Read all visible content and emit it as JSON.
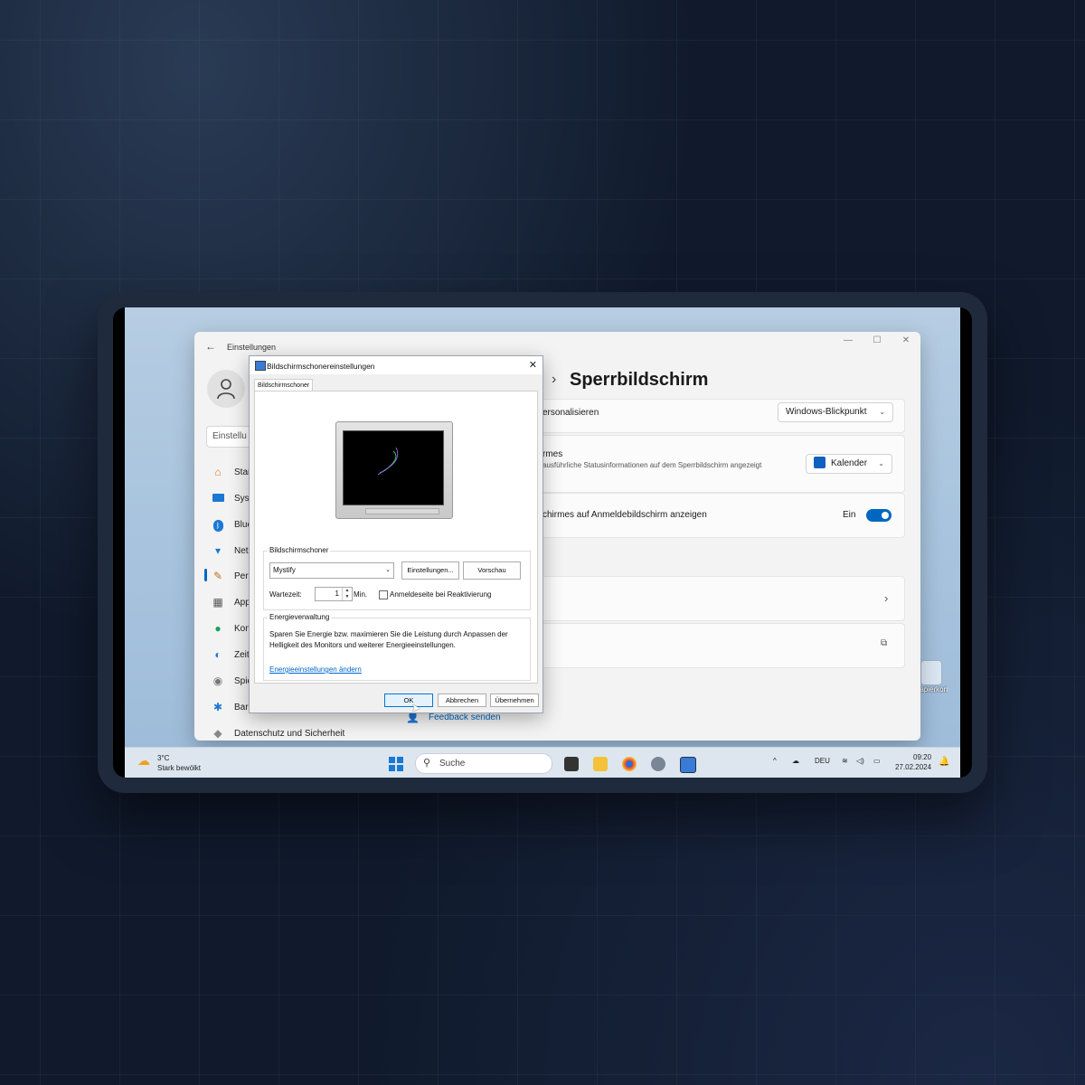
{
  "settings_window": {
    "title": "Einstellungen",
    "search_placeholder": "Einstellu",
    "breadcrumb_chevron": "›",
    "page_title": "Sperrbildschirm",
    "nav": [
      {
        "label": "Star",
        "icon": "home-icon"
      },
      {
        "label": "Syst",
        "icon": "system-icon"
      },
      {
        "label": "Blue",
        "icon": "bluetooth-icon"
      },
      {
        "label": "Net",
        "icon": "wifi-icon"
      },
      {
        "label": "Pers",
        "icon": "brush-icon"
      },
      {
        "label": "App",
        "icon": "apps-icon"
      },
      {
        "label": "Kon",
        "icon": "accounts-icon"
      },
      {
        "label": "Zeit",
        "icon": "time-icon"
      },
      {
        "label": "Spie",
        "icon": "gaming-icon"
      },
      {
        "label": "Barr",
        "icon": "accessibility-icon"
      },
      {
        "label": "Datenschutz und Sicherheit",
        "icon": "shield-icon"
      }
    ],
    "rows": {
      "personalize_label": "ersonalisieren",
      "personalize_value": "Windows-Blickpunkt",
      "status_label": "rmes",
      "status_desc": "ausführliche Statusinformationen auf dem Sperrbildschirm angezeigt",
      "status_value": "Kalender",
      "signin_label": "chirmes auf Anmeldebildschirm anzeigen",
      "signin_state": "Ein"
    },
    "feedback": "Feedback senden"
  },
  "dialog": {
    "title": "Bildschirmschonereinstellungen",
    "tab": "Bildschirmschoner",
    "group_screensaver": "Bildschirmschoner",
    "selected_saver": "Mystify",
    "settings_button": "Einstellungen...",
    "preview_button": "Vorschau",
    "wait_label": "Wartezeit:",
    "wait_value": "1",
    "wait_unit": "Min.",
    "resume_checkbox": "Anmeldeseite bei Reaktivierung",
    "group_power": "Energieverwaltung",
    "power_text": "Sparen Sie Energie bzw. maximieren Sie die Leistung durch Anpassen der Helligkeit des Monitors und weiterer Energieeinstellungen.",
    "power_link": "Energieeinstellungen ändern",
    "ok": "OK",
    "cancel": "Abbrechen",
    "apply": "Übernehmen"
  },
  "taskbar": {
    "temperature": "3°C",
    "weather": "Stark bewölkt",
    "search": "Suche",
    "language": "DEU",
    "time": "09:20",
    "date": "27.02.2024"
  },
  "desktop": {
    "icon_label": "Papierkorb"
  }
}
